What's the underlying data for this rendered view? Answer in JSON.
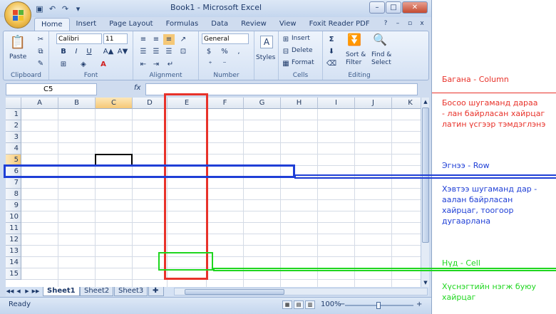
{
  "window": {
    "title": "Book1 - Microsoft Excel",
    "min_glyph": "–",
    "max_glyph": "□",
    "close_glyph": "✕",
    "doc_min_glyph": "–",
    "doc_max_glyph": "▫",
    "doc_close_glyph": "x",
    "help_glyph": "?"
  },
  "qat": {
    "save_icon": "save-icon",
    "undo_icon": "undo-icon",
    "redo_icon": "redo-icon"
  },
  "tabs": [
    "Home",
    "Insert",
    "Page Layout",
    "Formulas",
    "Data",
    "Review",
    "View",
    "Foxit Reader PDF"
  ],
  "ribbon": {
    "clipboard": {
      "label": "Clipboard",
      "paste": "Paste"
    },
    "font": {
      "label": "Font",
      "name": "Calibri",
      "size": "11",
      "bold": "B",
      "italic": "I",
      "underline": "U",
      "grow": "A▲",
      "shrink": "A▼",
      "color_a": "A"
    },
    "alignment": {
      "label": "Alignment"
    },
    "number": {
      "label": "Number",
      "format": "General",
      "currency": "$",
      "percent": "%",
      "comma": ","
    },
    "styles": {
      "label": "Styles"
    },
    "cells": {
      "label": "Cells",
      "insert": "Insert",
      "delete": "Delete",
      "format": "Format"
    },
    "editing": {
      "label": "Editing",
      "sum": "Σ",
      "sort": "Sort &",
      "filter": "Filter",
      "find": "Find &",
      "select": "Select"
    }
  },
  "formula_bar": {
    "name_box": "C5",
    "fx": "fx",
    "value": ""
  },
  "columns": [
    "A",
    "B",
    "C",
    "D",
    "E",
    "F",
    "G",
    "H",
    "I",
    "J",
    "K"
  ],
  "rows": [
    "1",
    "2",
    "3",
    "4",
    "5",
    "6",
    "7",
    "8",
    "9",
    "10",
    "11",
    "12",
    "13",
    "14",
    "15"
  ],
  "selected_cell": {
    "column": "C",
    "row": "5"
  },
  "sheets": [
    "Sheet1",
    "Sheet2",
    "Sheet3"
  ],
  "active_sheet": "Sheet1",
  "status": {
    "text": "Ready",
    "zoom": "100%",
    "zoom_minus": "−",
    "zoom_plus": "+"
  },
  "annotations": {
    "column_title": "Багана - Column",
    "column_desc": [
      "Босоо шугаманд дараа",
      "- лан байрласан хайрцаг",
      "латин үсгээр тэмдэглэнэ"
    ],
    "row_title": "Эгнээ - Row",
    "row_desc": [
      "Хэвтээ шугаманд дар -",
      "аалан байрласан",
      "хайрцаг, тоогоор",
      "дугаарлана"
    ],
    "cell_title": "Нүд - Cell",
    "cell_desc": [
      "Хүснэгтийн нэгж буюу",
      "хайрцаг"
    ]
  },
  "colors": {
    "column_box": "#e8322a",
    "row_box": "#1f3fd6",
    "cell_box": "#1fd61f"
  }
}
